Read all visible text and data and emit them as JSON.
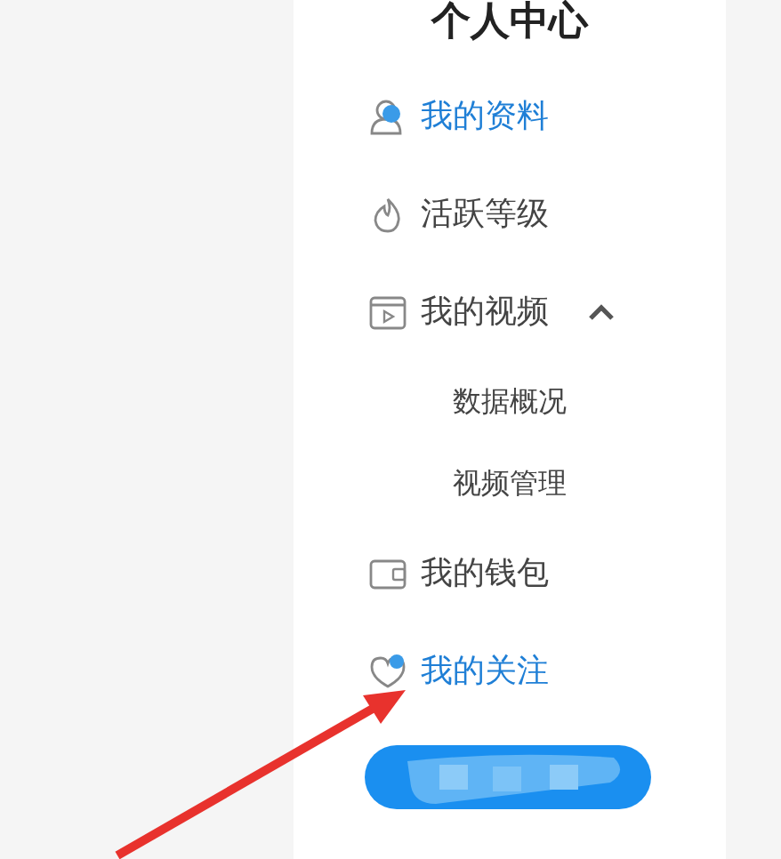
{
  "sidebar": {
    "title": "个人中心",
    "items": [
      {
        "kind": "item",
        "label": "我的资料",
        "selected": true
      },
      {
        "kind": "item",
        "label": "活跃等级",
        "selected": false
      },
      {
        "kind": "group",
        "label": "我的视频",
        "selected": false,
        "expanded": true,
        "children": [
          {
            "label": "数据概况",
            "selected": false
          },
          {
            "label": "视频管理",
            "selected": false
          }
        ]
      },
      {
        "kind": "item",
        "label": "我的钱包",
        "selected": false
      },
      {
        "kind": "item",
        "label": "我的关注",
        "selected": true
      }
    ]
  }
}
